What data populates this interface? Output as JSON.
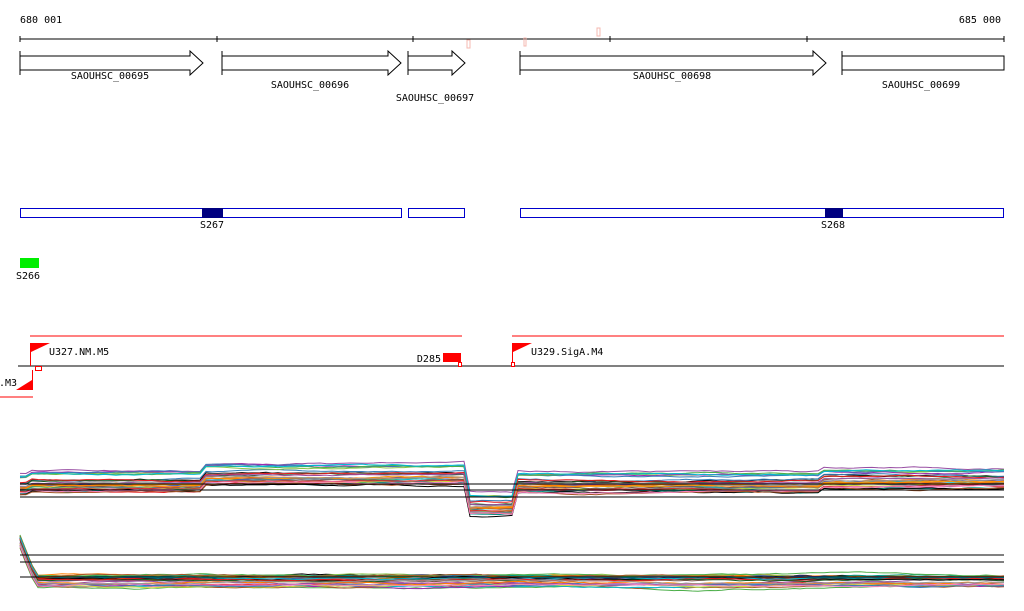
{
  "ruler": {
    "start_label": "680 001",
    "end_label": "685 000"
  },
  "genes": [
    {
      "name": "SAOUHSC_00695",
      "strand": "+"
    },
    {
      "name": "SAOUHSC_00696",
      "strand": "+"
    },
    {
      "name": "SAOUHSC_00697",
      "strand": "+"
    },
    {
      "name": "SAOUHSC_00698",
      "strand": "+"
    },
    {
      "name": "SAOUHSC_00699",
      "strand": "+"
    }
  ],
  "segments": [
    {
      "label": "S267",
      "color": "#000080"
    },
    {
      "label": "S268",
      "color": "#000080"
    },
    {
      "label": "S266",
      "color": "#00ee00"
    }
  ],
  "promoters": [
    {
      "label": "U327.NM.M5"
    },
    {
      "label": "U329.SigA.M4"
    },
    {
      "label": ".M3"
    }
  ],
  "terminators": [
    {
      "label": "D285"
    }
  ],
  "colors": {
    "feature_red": "#ff0000",
    "segment_outline": "#0000cc",
    "pink_mark": "#f4b8b0"
  },
  "expression_profiles": {
    "tracks": 2
  }
}
